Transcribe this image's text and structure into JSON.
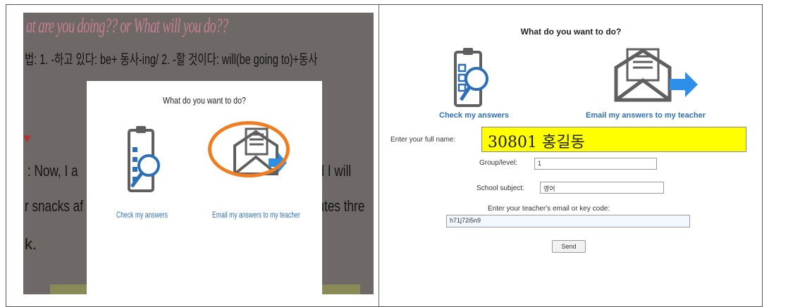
{
  "left_panel": {
    "background": {
      "title": "at are you doing?? or What will you do??",
      "grammar_line": "법: 1. -하고 있다: be+ 동사-ing/ 2. -할 것이다: will(be going to)+동사",
      "heart": "♥",
      "line_now": ": Now, I a",
      "line_snacks": "r snacks af",
      "line_k": "k.",
      "line_and": "nd I will",
      "line_nutes": "nutes thre"
    },
    "modal": {
      "title": "What do you want to do?",
      "check_label": "Check my answers",
      "email_label": "Email my answers to my teacher"
    }
  },
  "right_panel": {
    "title": "What do you want to do?",
    "check_label": "Check my answers",
    "email_label": "Email my answers to my teacher",
    "full_name_label": "Enter your full name:",
    "full_name_value": "30801 홍길동",
    "group_label": "Group/level:",
    "group_value": "1",
    "subject_label": "School subject:",
    "subject_value": "영어",
    "teacher_label": "Enter your teacher's email or key code:",
    "teacher_value": "h71j72i5n9",
    "send_label": "Send"
  },
  "colors": {
    "accent_blue": "#2d6fb7",
    "highlight_yellow": "#ffff00",
    "annotation_orange": "#ef7d22",
    "icon_gray": "#5f5f5f"
  },
  "icons": [
    "clipboard-magnifier-icon",
    "envelope-arrow-icon"
  ]
}
